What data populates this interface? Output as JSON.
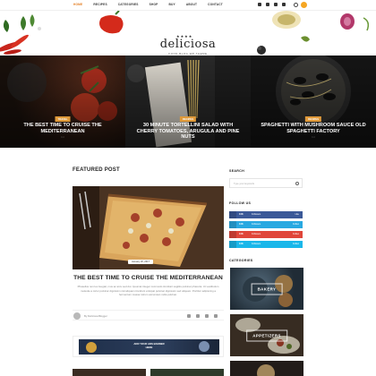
{
  "nav": {
    "links": [
      "Home",
      "Recipes",
      "Categories",
      "Shop",
      "Buy",
      "About",
      "Contact"
    ],
    "active_index": 0,
    "social_icons": [
      "facebook-icon",
      "twitter-icon",
      "google-plus-icon",
      "youtube-icon"
    ],
    "accent": "#e37b1d"
  },
  "header": {
    "stars": "★★★★",
    "logo": "deliciosa",
    "tagline": "Food Blog WP Theme"
  },
  "slider": {
    "slides": [
      {
        "category": "Travel",
        "title": "The Best Time to Cruise the Mediterranean",
        "meta": "○ ○"
      },
      {
        "category": "Recipes",
        "title": "30 Minute Tortellini Salad with Cherry Tomatoes, Arugula and Pine Nuts",
        "meta": "○ ○"
      },
      {
        "category": "Recipes",
        "title": "Spaghetti with Mushroom Sauce Old Spaghetti Factory",
        "meta": "○ ○"
      }
    ]
  },
  "featured": {
    "section_title": "Featured Post",
    "date": "January 20, 2017",
    "title": "The Best Time to Cruise the Mediterranean",
    "excerpt": "Phasellus non leo feugiat, mus ac arcu sed dui. Ipsumat integer commodo tincidunt sagittis pulvinar pharetra. Ut vestibulum molestie a tortor pulvinar dignissim nisl aliquam tincidunt volutpat pulvinar dignissim sed aliquam. Porttitor adipiscing a fermentum massa rutrum accumsan nulla pulvinar.",
    "author": "By Deliciosa Blogger",
    "share_icons": [
      "facebook-icon",
      "twitter-icon",
      "google-plus-icon",
      "pinterest-icon"
    ]
  },
  "ad": {
    "line1": "Add Your Ads Banner",
    "line2": "Here"
  },
  "sidebar": {
    "search_title": "Search",
    "search_placeholder": "Type your keywords",
    "follow_title": "Follow Us",
    "follow": [
      {
        "icon": "facebook-icon",
        "count": "10K",
        "label": "Followers",
        "action": "Like",
        "color": "#3b5998"
      },
      {
        "icon": "twitter-icon",
        "count": "10K",
        "label": "Followers",
        "action": "Follow",
        "color": "#29a9e1"
      },
      {
        "icon": "google-plus-icon",
        "count": "10K",
        "label": "Followers",
        "action": "Follow",
        "color": "#e0463a"
      },
      {
        "icon": "vimeo-icon",
        "count": "10K",
        "label": "Followers",
        "action": "Follow",
        "color": "#1ab7ea"
      }
    ],
    "categories_title": "Categories",
    "categories": [
      "Bakery",
      "Appetizers",
      "Dessert"
    ]
  }
}
